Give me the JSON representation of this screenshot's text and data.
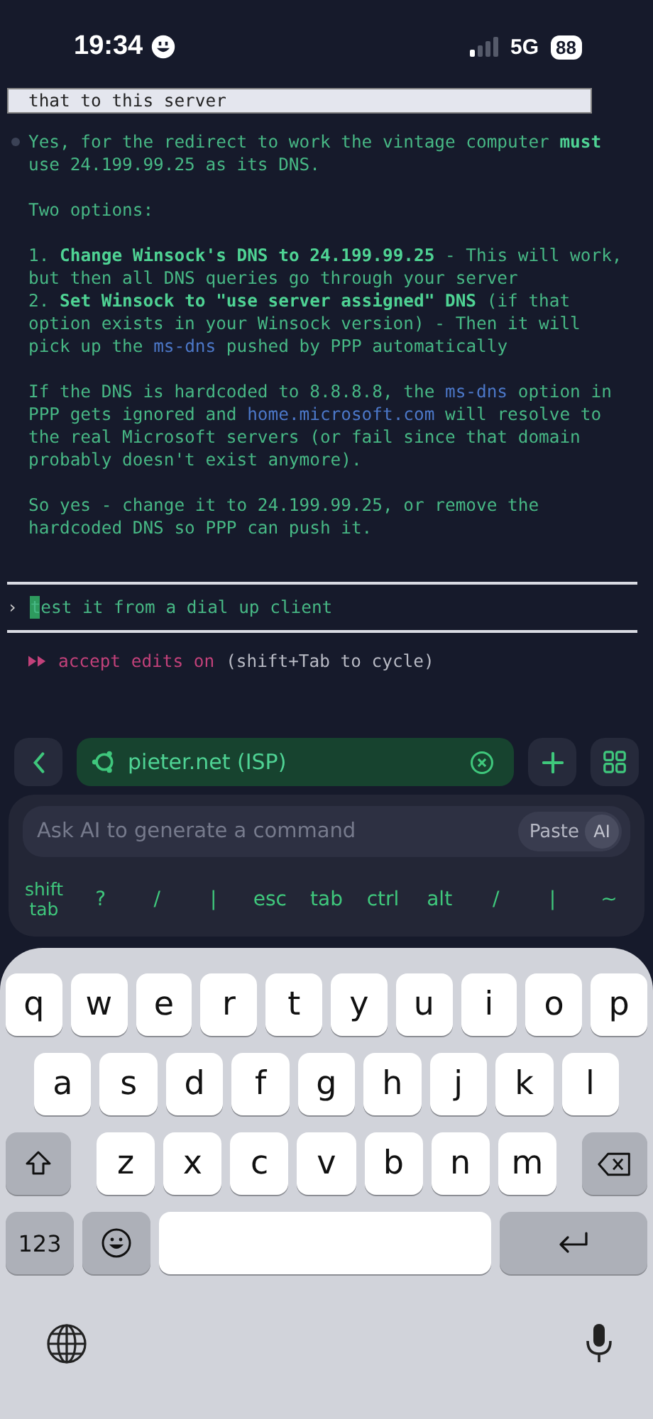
{
  "status_bar": {
    "time": "19:34",
    "network": "5G",
    "battery": "88"
  },
  "terminal": {
    "highlighted_line": "that to this server",
    "blocks": [
      {
        "kind": "bullet",
        "segments": [
          {
            "kind": "plain",
            "text": "Yes, for the redirect to work the vintage computer "
          },
          {
            "kind": "bold",
            "text": "must"
          },
          {
            "kind": "plain",
            "text": " use 24.199.99.25 as its DNS."
          }
        ]
      },
      {
        "kind": "para",
        "segments": [
          {
            "kind": "plain",
            "text": "Two options:"
          }
        ]
      },
      {
        "kind": "list",
        "items": [
          [
            {
              "kind": "plain",
              "text": "1. "
            },
            {
              "kind": "bold",
              "text": "Change Winsock's DNS to 24.199.99.25"
            },
            {
              "kind": "plain",
              "text": " - This will work, but then all DNS queries go through your server"
            }
          ],
          [
            {
              "kind": "plain",
              "text": "2. "
            },
            {
              "kind": "bold",
              "text": "Set Winsock to \"use server assigned\" DNS"
            },
            {
              "kind": "plain",
              "text": " (if that option exists in your Winsock version) - Then it will pick up the "
            },
            {
              "kind": "code",
              "text": "ms-dns"
            },
            {
              "kind": "plain",
              "text": " pushed by PPP automatically"
            }
          ]
        ]
      },
      {
        "kind": "para",
        "segments": [
          {
            "kind": "plain",
            "text": "If the DNS is hardcoded to 8.8.8.8, the "
          },
          {
            "kind": "code",
            "text": "ms-dns"
          },
          {
            "kind": "plain",
            "text": " option in PPP gets ignored and "
          },
          {
            "kind": "code",
            "text": "home.microsoft.com"
          },
          {
            "kind": "plain",
            "text": " will resolve to the real Microsoft servers (or fail since that domain probably doesn't exist anymore)."
          }
        ]
      },
      {
        "kind": "para",
        "segments": [
          {
            "kind": "plain",
            "text": "So yes - change it to 24.199.99.25, or remove the hardcoded DNS so PPP can push it."
          }
        ]
      }
    ],
    "prompt": {
      "symbol": "›",
      "text": "test it from a dial up client"
    },
    "mode": {
      "label": "accept edits on",
      "hint": "(shift+Tab to cycle)"
    }
  },
  "toolbar": {
    "host": "pieter.net (ISP)"
  },
  "ai_field": {
    "placeholder": "Ask AI to generate a command",
    "paste": "Paste",
    "ai": "AI"
  },
  "extra_keys": [
    "shift tab",
    "?",
    "/",
    "|",
    "esc",
    "tab",
    "ctrl",
    "alt",
    "/",
    "|",
    "~"
  ],
  "keyboard": {
    "rows": [
      [
        "q",
        "w",
        "e",
        "r",
        "t",
        "y",
        "u",
        "i",
        "o",
        "p"
      ],
      [
        "a",
        "s",
        "d",
        "f",
        "g",
        "h",
        "j",
        "k",
        "l"
      ],
      [
        "z",
        "x",
        "c",
        "v",
        "b",
        "n",
        "m"
      ]
    ],
    "numbers": "123"
  }
}
